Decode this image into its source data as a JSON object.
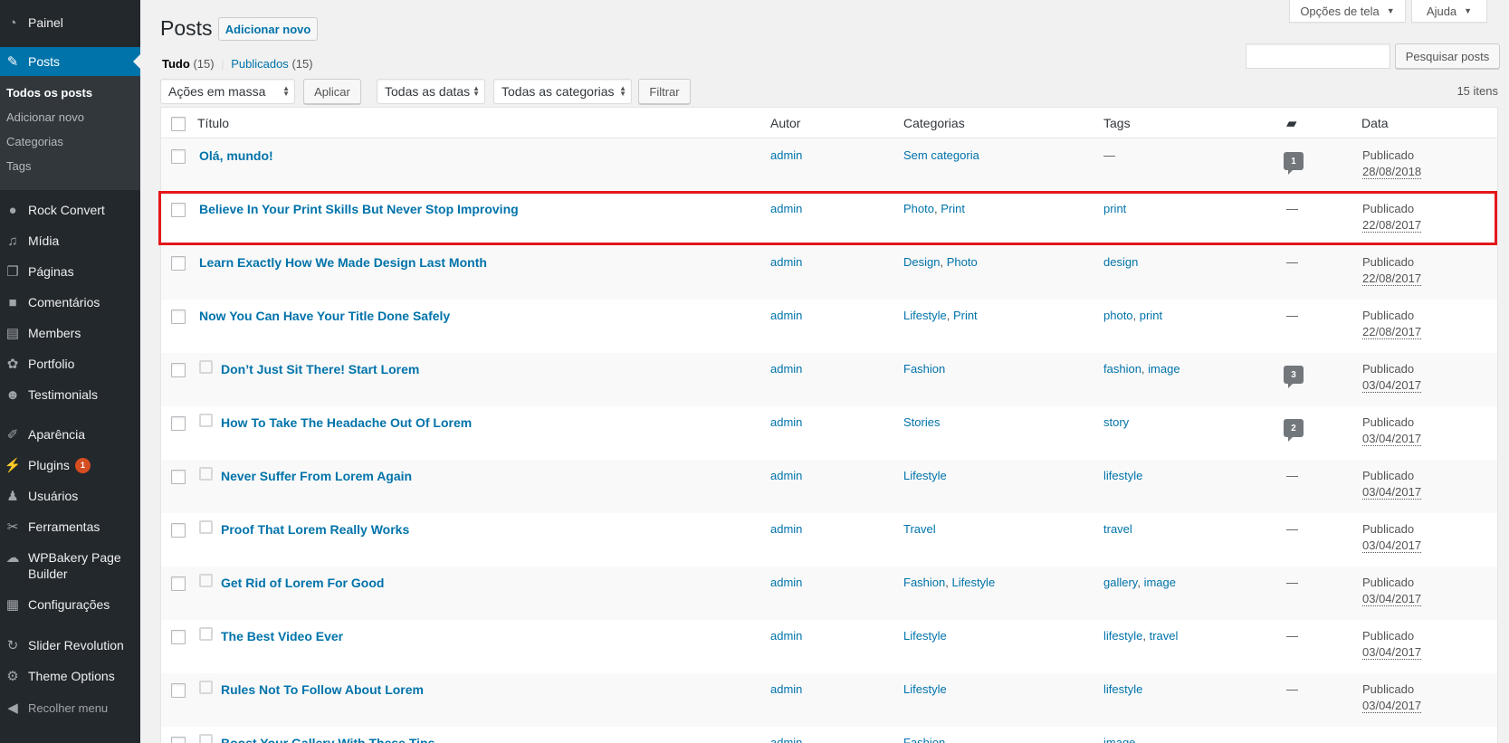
{
  "sidebar": {
    "painel": "Painel",
    "posts": "Posts",
    "submenu": [
      "Todos os posts",
      "Adicionar novo",
      "Categorias",
      "Tags"
    ],
    "items": [
      {
        "label": "Rock Convert",
        "icon": "rock-convert-icon"
      },
      {
        "label": "Mídia",
        "icon": "media-icon"
      },
      {
        "label": "Páginas",
        "icon": "pages-icon"
      },
      {
        "label": "Comentários",
        "icon": "comments-icon"
      },
      {
        "label": "Members",
        "icon": "members-icon"
      },
      {
        "label": "Portfolio",
        "icon": "portfolio-icon"
      },
      {
        "label": "Testimonials",
        "icon": "testimonials-icon"
      },
      {
        "label": "Aparência",
        "icon": "appearance-icon"
      },
      {
        "label": "Plugins",
        "icon": "plugins-icon",
        "badge": "1"
      },
      {
        "label": "Usuários",
        "icon": "users-icon"
      },
      {
        "label": "Ferramentas",
        "icon": "tools-icon"
      },
      {
        "label": "WPBakery Page Builder",
        "icon": "wpbakery-icon"
      },
      {
        "label": "Configurações",
        "icon": "settings-icon"
      },
      {
        "label": "Slider Revolution",
        "icon": "slider-revolution-icon"
      },
      {
        "label": "Theme Options",
        "icon": "theme-options-icon"
      }
    ],
    "collapse": "Recolher menu"
  },
  "header": {
    "title": "Posts",
    "add_new": "Adicionar novo",
    "screen_options": "Opções de tela",
    "help": "Ajuda"
  },
  "filters": {
    "all_label": "Tudo",
    "all_count": "(15)",
    "separator": "|",
    "published_label": "Publicados",
    "published_count": "(15)",
    "search_button": "Pesquisar posts",
    "bulk_actions": "Ações em massa",
    "apply": "Aplicar",
    "all_dates": "Todas as datas",
    "all_categories": "Todas as categorias",
    "filter": "Filtrar",
    "items_count": "15 itens"
  },
  "columns": {
    "title": "Título",
    "author": "Autor",
    "categories": "Categorias",
    "tags": "Tags",
    "date": "Data"
  },
  "posts": [
    {
      "title": "Olá, mundo!",
      "author": "admin",
      "categories": [
        "Sem categoria"
      ],
      "tags": [],
      "tags_empty": "—",
      "comments": "1",
      "status": "Publicado",
      "date": "28/08/2018",
      "format": false
    },
    {
      "title": "Believe In Your Print Skills But Never Stop Improving",
      "author": "admin",
      "categories": [
        "Photo",
        "Print"
      ],
      "tags": [
        "print"
      ],
      "comments_empty": "—",
      "status": "Publicado",
      "date": "22/08/2017",
      "format": false
    },
    {
      "title": "Learn Exactly How We Made Design Last Month",
      "author": "admin",
      "categories": [
        "Design",
        "Photo"
      ],
      "tags": [
        "design"
      ],
      "comments_empty": "—",
      "status": "Publicado",
      "date": "22/08/2017",
      "format": false
    },
    {
      "title": "Now You Can Have Your Title Done Safely",
      "author": "admin",
      "categories": [
        "Lifestyle",
        "Print"
      ],
      "tags": [
        "photo",
        "print"
      ],
      "comments_empty": "—",
      "status": "Publicado",
      "date": "22/08/2017",
      "format": false
    },
    {
      "title": "Don’t Just Sit There! Start Lorem",
      "author": "admin",
      "categories": [
        "Fashion"
      ],
      "tags": [
        "fashion",
        "image"
      ],
      "comments": "3",
      "status": "Publicado",
      "date": "03/04/2017",
      "format": true
    },
    {
      "title": "How To Take The Headache Out Of Lorem",
      "author": "admin",
      "categories": [
        "Stories"
      ],
      "tags": [
        "story"
      ],
      "comments": "2",
      "status": "Publicado",
      "date": "03/04/2017",
      "format": true
    },
    {
      "title": "Never Suffer From Lorem Again",
      "author": "admin",
      "categories": [
        "Lifestyle"
      ],
      "tags": [
        "lifestyle"
      ],
      "comments_empty": "—",
      "status": "Publicado",
      "date": "03/04/2017",
      "format": true
    },
    {
      "title": "Proof That Lorem Really Works",
      "author": "admin",
      "categories": [
        "Travel"
      ],
      "tags": [
        "travel"
      ],
      "comments_empty": "—",
      "status": "Publicado",
      "date": "03/04/2017",
      "format": true
    },
    {
      "title": "Get Rid of Lorem For Good",
      "author": "admin",
      "categories": [
        "Fashion",
        "Lifestyle"
      ],
      "tags": [
        "gallery",
        "image"
      ],
      "comments_empty": "—",
      "status": "Publicado",
      "date": "03/04/2017",
      "format": true
    },
    {
      "title": "The Best Video Ever",
      "author": "admin",
      "categories": [
        "Lifestyle"
      ],
      "tags": [
        "lifestyle",
        "travel"
      ],
      "comments_empty": "—",
      "status": "Publicado",
      "date": "03/04/2017",
      "format": true
    },
    {
      "title": "Rules Not To Follow About Lorem",
      "author": "admin",
      "categories": [
        "Lifestyle"
      ],
      "tags": [
        "lifestyle"
      ],
      "comments_empty": "—",
      "status": "Publicado",
      "date": "03/04/2017",
      "format": true
    },
    {
      "title": "Boost Your Gallery With These Tips",
      "author": "admin",
      "categories": [
        "Fashion"
      ],
      "tags": [
        "image"
      ],
      "comments_empty": "",
      "status": "",
      "date": "",
      "format": true
    }
  ],
  "colors": {
    "sidebar": "#23282d",
    "accent": "#0073aa",
    "highlight": "#e3171b",
    "badge": "#d54e21"
  }
}
